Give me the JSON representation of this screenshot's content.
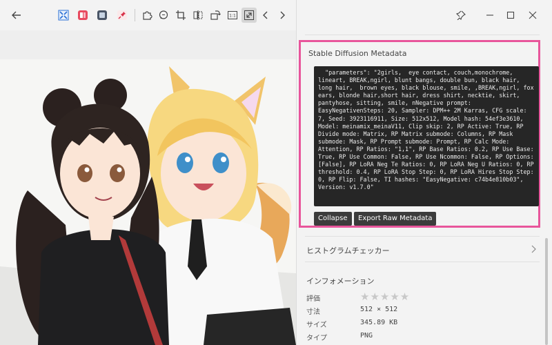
{
  "toolbar": {
    "icons": [
      "back-arrow-icon",
      "fit-screen-icon",
      "app-icon-red",
      "app-icon-gray",
      "pin-app-icon",
      "puzzle-icon",
      "chat-icon",
      "crop-icon",
      "compare-icon",
      "rotate-icon",
      "actual-size-icon",
      "fullscreen-icon",
      "chevron-left-icon",
      "chevron-right-icon"
    ],
    "actual_size_label": "1:1"
  },
  "window": {
    "buttons": [
      "pin-icon",
      "minimize-icon",
      "maximize-icon",
      "close-icon"
    ]
  },
  "metadata": {
    "title": "Stable Diffusion Metadata",
    "text": "  \"parameters\": \"2girls,  eye contact, couch,monochrome, lineart, BREAK,ngirl, blunt bangs, double bun, black hair, long hair,  brown eyes, black blouse, smile, ,BREAK,ngirl, fox ears, blonde hair,short hair, dress shirt, necktie, skirt, pantyhose, sitting, smile, nNegative prompt:  EasyNegativenSteps: 20, Sampler: DPM++ 2M Karras, CFG scale: 7, Seed: 3923116911, Size: 512x512, Model hash: 54ef3e3610, Model: meinamix_meinaV11, Clip skip: 2, RP Active: True, RP Divide mode: Matrix, RP Matrix submode: Columns, RP Mask submode: Mask, RP Prompt submode: Prompt, RP Calc Mode: Attention, RP Ratios: \"1,1\", RP Base Ratios: 0.2, RP Use Base: True, RP Use Common: False, RP Use Ncommon: False, RP Options: [False], RP LoRA Neg Te Ratios: 0, RP LoRA Neg U Ratios: 0, RP threshold: 0.4, RP LoRA Stop Step: 0, RP LoRA Hires Stop Step: 0, RP Flip: False, TI hashes: \"EasyNegative: c74b4e810b03\", Version: v1.7.0\"",
    "collapse_label": "Collapse",
    "export_label": "Export Raw Metadata"
  },
  "histogram": {
    "label": "ヒストグラムチェッカー"
  },
  "info": {
    "title": "インフォメーション",
    "rows": [
      {
        "key": "評価",
        "value": ""
      },
      {
        "key": "寸法",
        "value": "512 × 512"
      },
      {
        "key": "サイズ",
        "value": "345.89 KB"
      },
      {
        "key": "タイプ",
        "value": "PNG"
      }
    ],
    "rating": 0,
    "rating_max": 5,
    "stars": "★★★★★"
  }
}
